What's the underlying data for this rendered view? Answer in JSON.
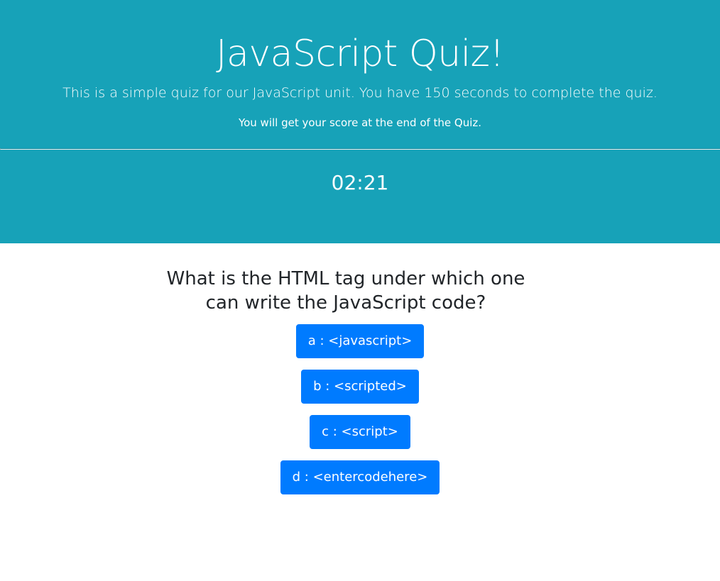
{
  "header": {
    "title": "JavaScript Quiz!",
    "lead": "This is a simple quiz for our JavaScript unit. You have 150 seconds to complete the quiz.",
    "note": "You will get your score at the end of the Quiz.",
    "timer": "02:21"
  },
  "quiz": {
    "question": "What is the HTML tag under which one can write the JavaScript code?",
    "choices": [
      {
        "label": "a : <javascript>"
      },
      {
        "label": "b : <scripted>"
      },
      {
        "label": "c : <script>"
      },
      {
        "label": "d : <entercodehere>"
      }
    ]
  },
  "colors": {
    "hero_bg": "#17a2b8",
    "button_bg": "#007bff",
    "question_text": "#212529"
  }
}
